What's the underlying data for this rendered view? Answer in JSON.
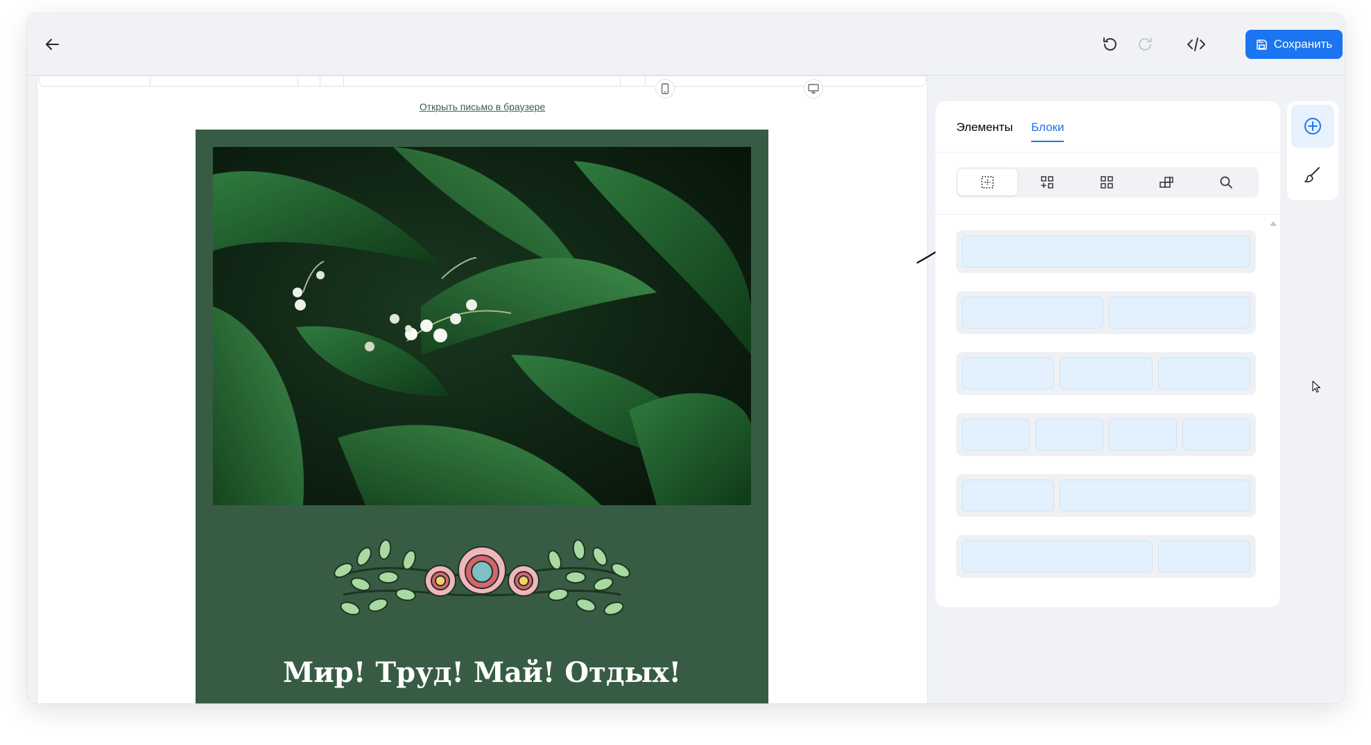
{
  "toolbar": {
    "back_icon": "arrow-left-icon",
    "undo_icon": "undo-icon",
    "redo_icon": "redo-icon",
    "code_icon": "code-icon",
    "save_label": "Сохранить",
    "save_icon": "floppy-disk-icon"
  },
  "editor": {
    "browser_link": "Открыть письмо в браузере",
    "preview_devices": [
      "mobile-icon",
      "desktop-icon"
    ],
    "email": {
      "background_color": "#375c43",
      "title": "Мир! Труд! Май! Отдых!"
    }
  },
  "panel": {
    "tabs": [
      {
        "label": "Элементы",
        "active": false
      },
      {
        "label": "Блоки",
        "active": true
      }
    ],
    "filters": [
      {
        "icon": "empty-block-icon",
        "active": true
      },
      {
        "icon": "add-block-icon",
        "active": false
      },
      {
        "icon": "grid-blocks-icon",
        "active": false
      },
      {
        "icon": "composite-blocks-icon",
        "active": false
      },
      {
        "icon": "search-icon",
        "active": false
      }
    ],
    "layouts": [
      {
        "columns": "1"
      },
      {
        "columns": "1:1"
      },
      {
        "columns": "1:1:1"
      },
      {
        "columns": "1:1:1:1"
      },
      {
        "columns": "1:2"
      },
      {
        "columns": "2:1"
      }
    ]
  },
  "sidebar": {
    "buttons": [
      {
        "icon": "plus-circle-icon",
        "active": true
      },
      {
        "icon": "brush-icon",
        "active": false
      }
    ]
  },
  "colors": {
    "accent": "#1b74f1",
    "cell_fill": "#e2f1fd",
    "email_green": "#375c43"
  }
}
